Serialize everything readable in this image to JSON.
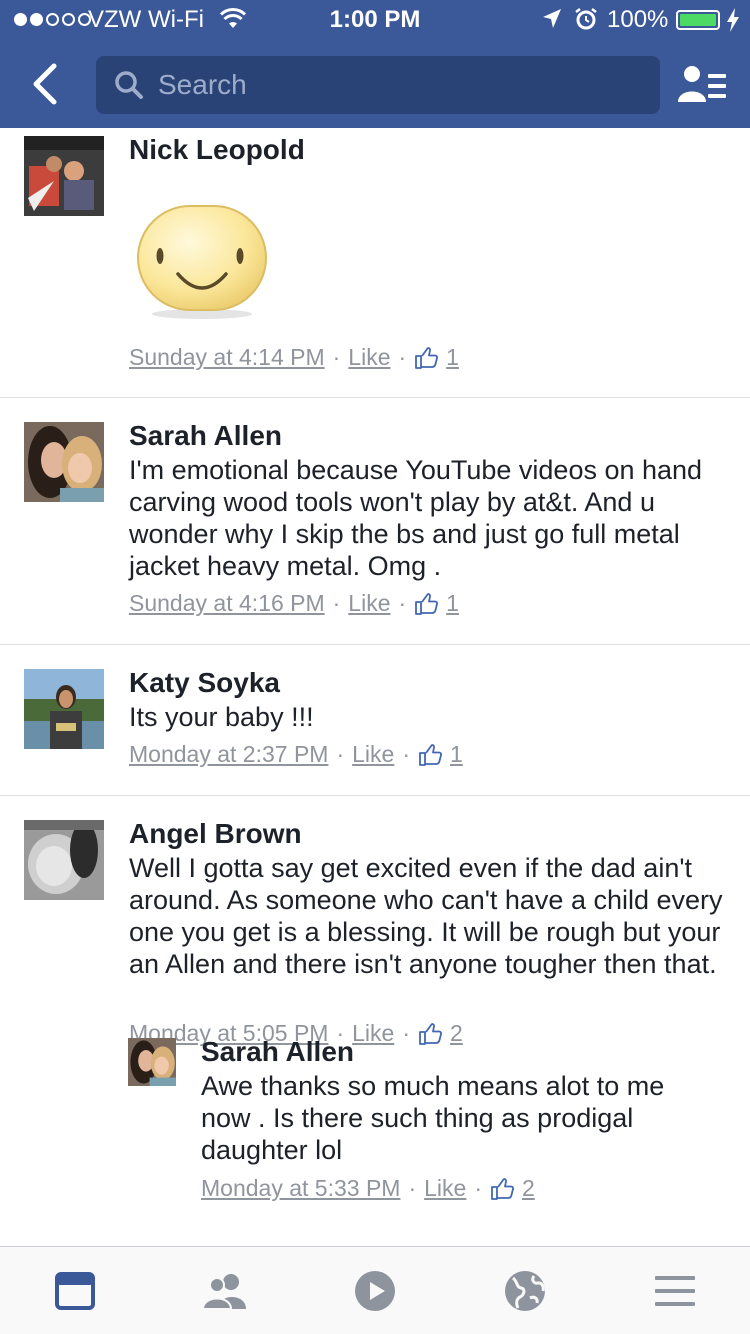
{
  "status_bar": {
    "carrier": "VZW Wi-Fi",
    "time": "1:00 PM",
    "battery": "100%",
    "signal_bars": 2
  },
  "search": {
    "placeholder": "Search"
  },
  "comments": [
    {
      "name": "Nick Leopold",
      "text": "",
      "sticker": "smiley-sticker",
      "time": "Sunday at 4:14 PM",
      "like_label": "Like",
      "likes": "1"
    },
    {
      "name": "Sarah Allen",
      "text": "I'm emotional because YouTube videos on hand carving wood tools won't play by at&t. And u wonder why I skip the bs and just go full metal jacket heavy metal. Omg .",
      "time": "Sunday at 4:16 PM",
      "like_label": "Like",
      "likes": "1"
    },
    {
      "name": "Katy Soyka",
      "text": "Its your baby !!!",
      "time": "Monday at 2:37 PM",
      "like_label": "Like",
      "likes": "1"
    },
    {
      "name": "Angel Brown",
      "text": "Well I gotta say get excited even if the dad ain't around. As someone who can't have a child every one you get is a blessing. It will be rough but your an Allen and there isn't anyone tougher then that.",
      "time": "Monday at 5:05 PM",
      "like_label": "Like",
      "likes": "2",
      "reply": {
        "name": "Sarah Allen",
        "text": "Awe thanks so much means alot to me now . Is there such thing as prodigal daughter lol",
        "time": "Monday at 5:33 PM",
        "like_label": "Like",
        "likes": "2"
      }
    }
  ],
  "tabs": [
    "news-feed",
    "friends",
    "video",
    "notifications-globe",
    "menu"
  ],
  "colors": {
    "brand": "#3b5998",
    "search_bg": "#2a4377",
    "meta_text": "#90949c",
    "like_icon": "#4267b2",
    "battery": "#4cd964",
    "active_tab": "#3b5998",
    "inactive_tab": "#8d949e"
  }
}
